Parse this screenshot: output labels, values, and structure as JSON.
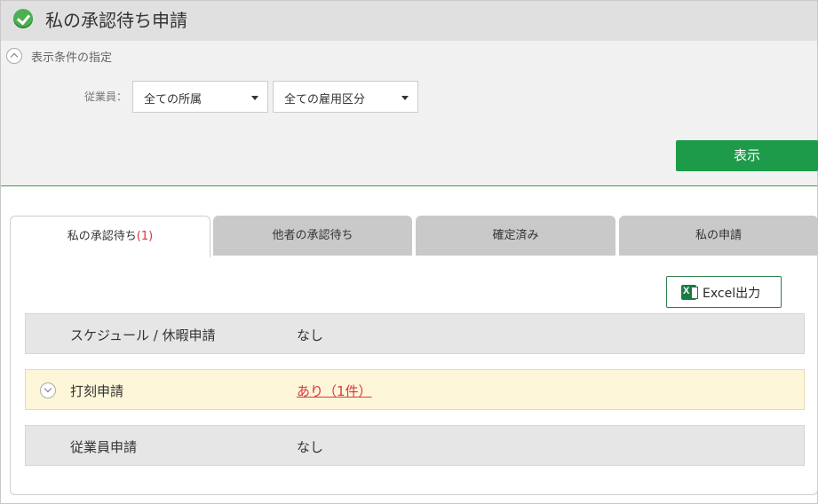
{
  "header": {
    "title": "私の承認待ち申請",
    "icon": "check-circle-icon"
  },
  "filter": {
    "section_label": "表示条件の指定",
    "employee_label": "従業員：",
    "department_select": "全ての所属",
    "employment_select": "全ての雇用区分",
    "show_button": "表示"
  },
  "tabs": [
    {
      "label": "私の承認待ち",
      "count": "(1)",
      "active": true
    },
    {
      "label": "他者の承認待ち",
      "active": false
    },
    {
      "label": "確定済み",
      "active": false
    },
    {
      "label": "私の申請",
      "active": false
    }
  ],
  "excel_button": "Excel出力",
  "rows": [
    {
      "name": "スケジュール / 休暇申請",
      "value": "なし"
    },
    {
      "name": "打刻申請",
      "value": "あり（1件）",
      "highlight": true
    },
    {
      "name": "従業員申請",
      "value": "なし"
    }
  ],
  "colors": {
    "accent": "#1e9b4a",
    "alert": "#d9363e",
    "highlight_row": "#fdf6d8"
  }
}
